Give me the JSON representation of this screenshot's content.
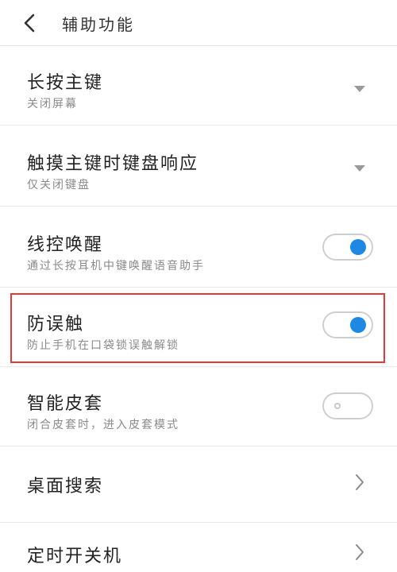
{
  "header": {
    "title": "辅助功能"
  },
  "colors": {
    "accent": "#1e88e5",
    "highlight": "#e53935"
  },
  "items": [
    {
      "title": "长按主键",
      "subtitle": "关闭屏幕",
      "control": "dropdown-arrow"
    },
    {
      "title": "触摸主键时键盘响应",
      "subtitle": "仅关闭键盘",
      "control": "dropdown-arrow"
    },
    {
      "title": "线控唤醒",
      "subtitle": "通过长按耳机中键唤醒语音助手",
      "control": "toggle",
      "enabled": true
    },
    {
      "title": "防误触",
      "subtitle": "防止手机在口袋锁误触解锁",
      "control": "toggle",
      "enabled": true,
      "highlighted": true
    },
    {
      "title": "智能皮套",
      "subtitle": "闭合皮套时，进入皮套模式",
      "control": "toggle",
      "enabled": false
    },
    {
      "title": "桌面搜索",
      "control": "chevron-right"
    },
    {
      "title": "定时开关机",
      "control": "chevron-right"
    }
  ]
}
